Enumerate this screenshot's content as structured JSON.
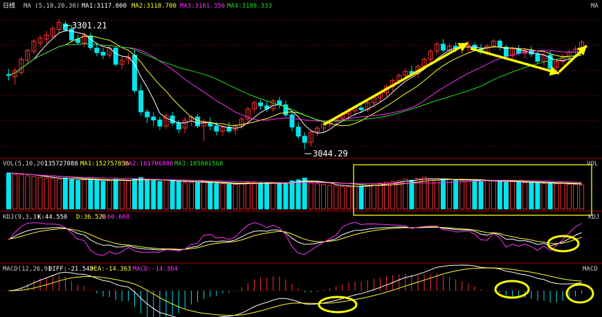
{
  "colors": {
    "background": "#000000",
    "up": "#ff3232",
    "down": "#00e5ee",
    "white_line": "#ffffff",
    "yellow_line": "#ffff33",
    "magenta_line": "#ff33ff",
    "green_line": "#22dd22",
    "grid": "#b40000",
    "annotation": "#ffff00"
  },
  "main_panel": {
    "period_label": "日线",
    "ma_params": "MA (5,10,20,30)",
    "ma1": "MA1:3117.800",
    "ma2": "MA2:3118.700",
    "ma3": "MA3:3161.350",
    "ma4": "MA4:3188.333",
    "corner_label": "MA",
    "high_label": "3301.21",
    "low_label": "3044.29"
  },
  "vol_panel": {
    "title": "VOL(5,10,20)",
    "value": "135727088",
    "ma1": "MA1:152757856",
    "ma2": "MA2:161706800",
    "ma3": "MA3:185001568",
    "corner_label": "VOL"
  },
  "kdj_panel": {
    "title": "KDJ(9,3,3)",
    "k": "K:44.550",
    "d": "D:36.520",
    "j": "J:60.608",
    "corner_label": "KDJ"
  },
  "macd_panel": {
    "title": "MACD(12,26,9)",
    "diff": "DIFF:-21.545",
    "dea": "DEA:-14.363",
    "macd": "MACD:-14.364",
    "corner_label": "MACD"
  },
  "chart_data": {
    "type": "candlestick",
    "ohlc": [
      [
        3192,
        3203,
        3180,
        3190
      ],
      [
        3188,
        3205,
        3172,
        3200
      ],
      [
        3196,
        3225,
        3191,
        3222
      ],
      [
        3220,
        3242,
        3214,
        3240
      ],
      [
        3238,
        3262,
        3232,
        3258
      ],
      [
        3254,
        3270,
        3246,
        3264
      ],
      [
        3262,
        3278,
        3254,
        3270
      ],
      [
        3268,
        3288,
        3262,
        3283
      ],
      [
        3281,
        3301,
        3275,
        3295
      ],
      [
        3292,
        3298,
        3276,
        3280
      ],
      [
        3282,
        3290,
        3256,
        3260
      ],
      [
        3262,
        3270,
        3250,
        3255
      ],
      [
        3254,
        3274,
        3246,
        3270
      ],
      [
        3268,
        3274,
        3240,
        3245
      ],
      [
        3244,
        3255,
        3228,
        3235
      ],
      [
        3236,
        3244,
        3222,
        3230
      ],
      [
        3230,
        3248,
        3224,
        3244
      ],
      [
        3244,
        3248,
        3208,
        3212
      ],
      [
        3212,
        3226,
        3203,
        3220
      ],
      [
        3222,
        3234,
        3212,
        3226
      ],
      [
        3230,
        3240,
        3155,
        3160
      ],
      [
        3160,
        3172,
        3110,
        3118
      ],
      [
        3118,
        3124,
        3096,
        3108
      ],
      [
        3108,
        3118,
        3090,
        3102
      ],
      [
        3102,
        3108,
        3082,
        3090
      ],
      [
        3090,
        3114,
        3084,
        3110
      ],
      [
        3110,
        3118,
        3090,
        3096
      ],
      [
        3096,
        3102,
        3076,
        3084
      ],
      [
        3086,
        3108,
        3076,
        3102
      ],
      [
        3102,
        3112,
        3090,
        3108
      ],
      [
        3108,
        3114,
        3086,
        3090
      ],
      [
        3090,
        3104,
        3060,
        3098
      ],
      [
        3096,
        3108,
        3082,
        3090
      ],
      [
        3090,
        3098,
        3072,
        3080
      ],
      [
        3080,
        3092,
        3070,
        3088
      ],
      [
        3088,
        3098,
        3076,
        3080
      ],
      [
        3082,
        3094,
        3072,
        3090
      ],
      [
        3090,
        3108,
        3084,
        3104
      ],
      [
        3104,
        3128,
        3098,
        3124
      ],
      [
        3124,
        3140,
        3116,
        3136
      ],
      [
        3136,
        3142,
        3122,
        3130
      ],
      [
        3130,
        3140,
        3118,
        3124
      ],
      [
        3124,
        3144,
        3118,
        3140
      ],
      [
        3140,
        3148,
        3124,
        3132
      ],
      [
        3132,
        3140,
        3108,
        3112
      ],
      [
        3112,
        3118,
        3080,
        3088
      ],
      [
        3088,
        3098,
        3064,
        3070
      ],
      [
        3070,
        3078,
        3044,
        3058
      ],
      [
        3058,
        3082,
        3050,
        3078
      ],
      [
        3078,
        3090,
        3070,
        3086
      ],
      [
        3086,
        3098,
        3078,
        3094
      ],
      [
        3094,
        3104,
        3086,
        3100
      ],
      [
        3100,
        3110,
        3090,
        3106
      ],
      [
        3106,
        3118,
        3098,
        3114
      ],
      [
        3114,
        3126,
        3104,
        3120
      ],
      [
        3120,
        3130,
        3110,
        3126
      ],
      [
        3126,
        3136,
        3116,
        3122
      ],
      [
        3122,
        3140,
        3118,
        3136
      ],
      [
        3136,
        3150,
        3126,
        3146
      ],
      [
        3146,
        3160,
        3138,
        3156
      ],
      [
        3156,
        3172,
        3148,
        3168
      ],
      [
        3168,
        3184,
        3160,
        3180
      ],
      [
        3180,
        3194,
        3172,
        3190
      ],
      [
        3190,
        3204,
        3182,
        3198
      ],
      [
        3198,
        3210,
        3188,
        3194
      ],
      [
        3194,
        3212,
        3186,
        3208
      ],
      [
        3208,
        3226,
        3202,
        3222
      ],
      [
        3222,
        3242,
        3214,
        3238
      ],
      [
        3238,
        3256,
        3230,
        3252
      ],
      [
        3252,
        3262,
        3236,
        3240
      ],
      [
        3240,
        3254,
        3232,
        3248
      ],
      [
        3248,
        3256,
        3236,
        3244
      ],
      [
        3244,
        3252,
        3232,
        3248
      ],
      [
        3248,
        3258,
        3236,
        3250
      ],
      [
        3250,
        3256,
        3238,
        3242
      ],
      [
        3242,
        3252,
        3232,
        3236
      ],
      [
        3236,
        3252,
        3230,
        3248
      ],
      [
        3248,
        3262,
        3244,
        3258
      ],
      [
        3258,
        3262,
        3240,
        3246
      ],
      [
        3246,
        3250,
        3222,
        3228
      ],
      [
        3230,
        3246,
        3224,
        3242
      ],
      [
        3242,
        3250,
        3230,
        3234
      ],
      [
        3234,
        3244,
        3224,
        3240
      ],
      [
        3240,
        3248,
        3226,
        3232
      ],
      [
        3232,
        3238,
        3212,
        3218
      ],
      [
        3218,
        3236,
        3208,
        3230
      ],
      [
        3230,
        3238,
        3200,
        3204
      ],
      [
        3206,
        3222,
        3196,
        3218
      ],
      [
        3218,
        3232,
        3210,
        3226
      ],
      [
        3226,
        3240,
        3218,
        3236
      ],
      [
        3236,
        3248,
        3226,
        3242
      ],
      [
        3242,
        3260,
        3236,
        3256
      ]
    ],
    "volume": [
      270,
      262,
      258,
      248,
      242,
      236,
      230,
      228,
      222,
      232,
      220,
      214,
      218,
      226,
      214,
      208,
      212,
      222,
      216,
      210,
      228,
      236,
      222,
      212,
      206,
      214,
      210,
      204,
      200,
      198,
      196,
      204,
      196,
      190,
      188,
      186,
      184,
      190,
      198,
      196,
      194,
      192,
      200,
      196,
      194,
      210,
      218,
      232,
      196,
      188,
      182,
      176,
      172,
      168,
      166,
      170,
      172,
      178,
      186,
      194,
      200,
      206,
      212,
      224,
      216,
      230,
      238,
      224,
      216,
      220,
      222,
      218,
      214,
      216,
      210,
      204,
      214,
      212,
      206,
      200,
      204,
      200,
      198,
      194,
      196,
      192,
      194,
      188,
      192,
      186,
      184,
      180
    ]
  }
}
